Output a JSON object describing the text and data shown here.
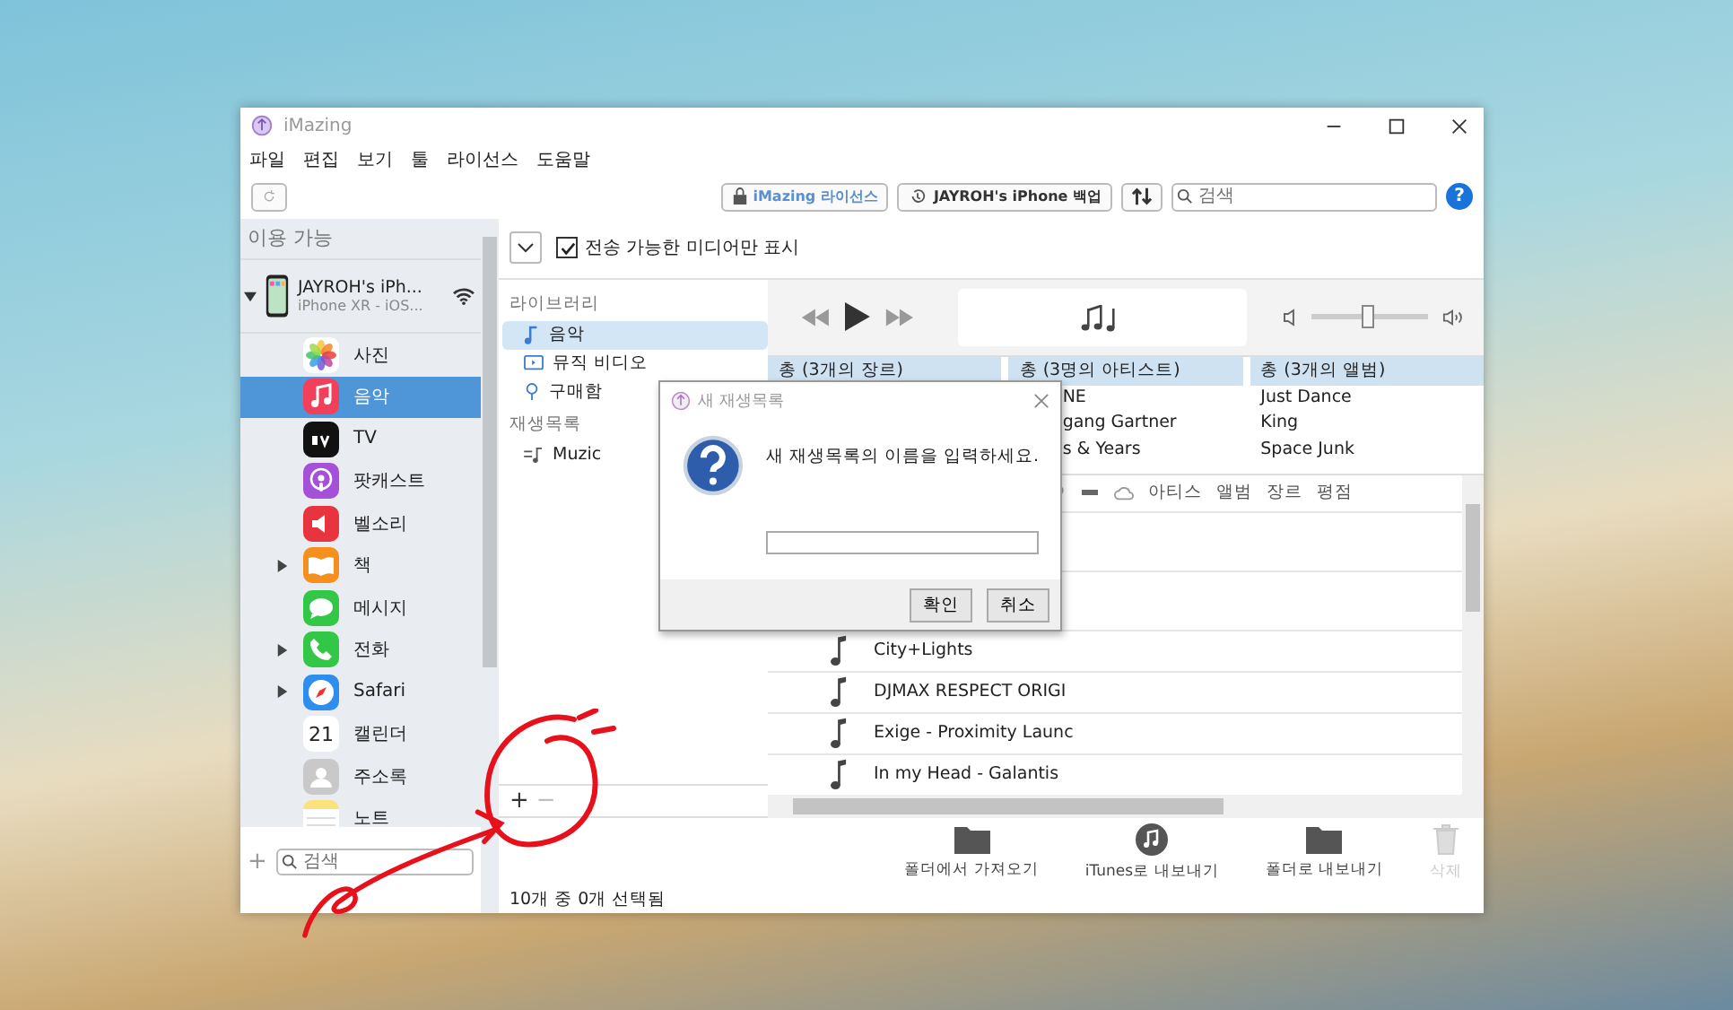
{
  "window": {
    "title": "iMazing"
  },
  "menu": [
    "파일",
    "편집",
    "보기",
    "툴",
    "라이선스",
    "도움말"
  ],
  "toolbar": {
    "license_button": "iMazing 라이선스",
    "backup_button": "JAYROH's iPhone 백업",
    "search": {
      "placeholder": "검색"
    },
    "help": "?"
  },
  "sidebar": {
    "header": "이용 가능",
    "device": {
      "name": "JAYROH's iPh...",
      "subtitle": "iPhone XR - iOS...",
      "expanded": true
    },
    "items": [
      {
        "label": "사진",
        "selected": false,
        "expander": false
      },
      {
        "label": "음악",
        "selected": true,
        "expander": false
      },
      {
        "label": "TV",
        "selected": false,
        "expander": false
      },
      {
        "label": "팟캐스트",
        "selected": false,
        "expander": false
      },
      {
        "label": "벨소리",
        "selected": false,
        "expander": false
      },
      {
        "label": "책",
        "selected": false,
        "expander": true
      },
      {
        "label": "메시지",
        "selected": false,
        "expander": false
      },
      {
        "label": "전화",
        "selected": false,
        "expander": true
      },
      {
        "label": "Safari",
        "selected": false,
        "expander": true
      },
      {
        "label": "캘린더",
        "selected": false,
        "expander": false,
        "icon_text": "21"
      },
      {
        "label": "주소록",
        "selected": false,
        "expander": false
      },
      {
        "label": "노트",
        "selected": false,
        "expander": false
      }
    ],
    "add": "+",
    "search": {
      "placeholder": "검색"
    }
  },
  "filter": {
    "label": "전송 가능한 미디어만 표시",
    "checked": true
  },
  "library": {
    "header": "라이브러리",
    "items": [
      {
        "label": "음악",
        "selected": true,
        "kind": "music"
      },
      {
        "label": "뮤직 비디오",
        "selected": false,
        "kind": "video"
      },
      {
        "label": "구매함",
        "selected": false,
        "kind": "purchased"
      }
    ],
    "playlists_header": "재생목록",
    "playlists": [
      {
        "label": "Muzic",
        "selected": false
      }
    ],
    "add": "+",
    "remove": "−"
  },
  "player": {
    "volume": {
      "level": 0.5
    }
  },
  "browser": [
    {
      "header": "총 (3개의 장르)"
    },
    {
      "header": "총 (3명의 아티스트)",
      "items": [
        "NE",
        "gang Gartner",
        "s & Years"
      ]
    },
    {
      "header": "총 (3개의 앨범)",
      "items": [
        "Just Dance",
        "King",
        "Space Junk"
      ]
    }
  ],
  "tracks": {
    "columns": [
      "아티스",
      "앨범",
      "장르",
      "평점"
    ],
    "rows": [
      "City+Lights",
      "DJMAX RESPECT ORIGI",
      "Exige - Proximity Launc",
      "In my Head - Galantis"
    ]
  },
  "actions": [
    {
      "label": "폴더에서 가져오기",
      "kind": "folder",
      "disabled": false
    },
    {
      "label": "iTunes로 내보내기",
      "kind": "itunes",
      "disabled": false
    },
    {
      "label": "폴더로 내보내기",
      "kind": "folder",
      "disabled": false
    },
    {
      "label": "삭제",
      "kind": "trash",
      "disabled": true
    }
  ],
  "status_bar": "10개 중 0개 선택됨",
  "dialog": {
    "title": "새 재생목록",
    "message": "새 재생목록의 이름을 입력하세요.",
    "buttons": [
      "확인",
      "취소"
    ]
  }
}
